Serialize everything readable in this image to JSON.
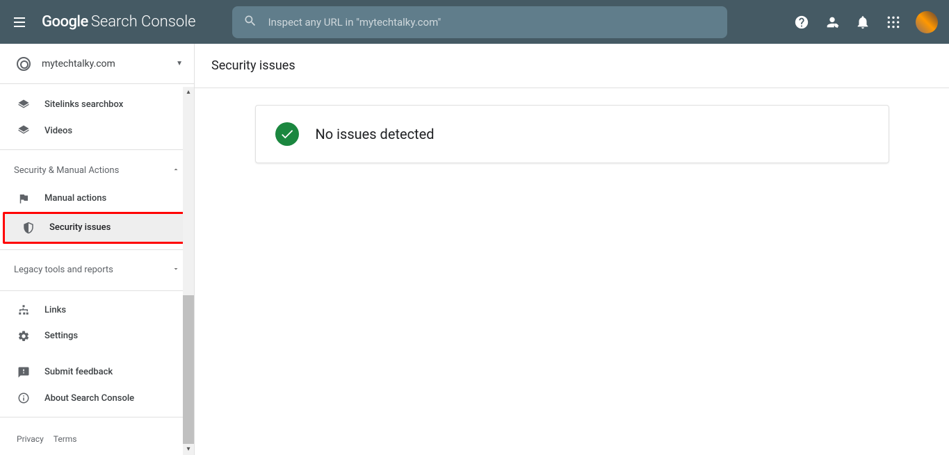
{
  "header": {
    "logo_primary": "Google",
    "logo_secondary": "Search Console",
    "search_placeholder": "Inspect any URL in \"mytechtalky.com\""
  },
  "sidebar": {
    "property": "mytechtalky.com",
    "items_top": [
      {
        "label": "Sitelinks searchbox",
        "icon": "layers"
      },
      {
        "label": "Videos",
        "icon": "layers"
      }
    ],
    "section_security": "Security & Manual Actions",
    "items_security": [
      {
        "label": "Manual actions",
        "icon": "flag"
      },
      {
        "label": "Security issues",
        "icon": "shield"
      }
    ],
    "section_legacy": "Legacy tools and reports",
    "items_bottom": [
      {
        "label": "Links",
        "icon": "sitemap"
      },
      {
        "label": "Settings",
        "icon": "gear"
      }
    ],
    "items_footer": [
      {
        "label": "Submit feedback",
        "icon": "feedback"
      },
      {
        "label": "About Search Console",
        "icon": "info"
      }
    ],
    "footer_links": [
      "Privacy",
      "Terms"
    ]
  },
  "main": {
    "title": "Security issues",
    "status_text": "No issues detected"
  }
}
